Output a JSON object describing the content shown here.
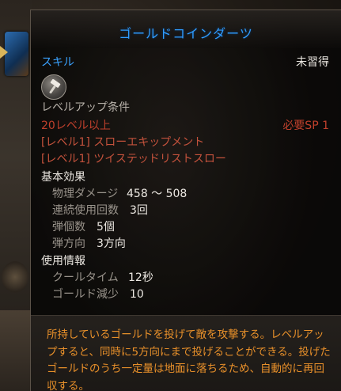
{
  "tooltip": {
    "title": "ゴールドコインダーツ",
    "skill_label": "スキル",
    "learn_status": "未習得",
    "skill_icon": "hammer-icon",
    "req_header": "レベルアップ条件",
    "req_level": "20レベル以上",
    "req_sp": "必要SP 1",
    "prereqs": [
      "[レベル1] スローエキップメント",
      "[レベル1] ツイステッドリストスロー"
    ],
    "basic_header": "基本効果",
    "stats": [
      {
        "label": "物理ダメージ",
        "value": "458 ～ 508"
      },
      {
        "label": "連続使用回数",
        "value": "3回"
      },
      {
        "label": "弾個数",
        "value": "5個"
      },
      {
        "label": "弾方向",
        "value": "3方向"
      }
    ],
    "usage_header": "使用情報",
    "usage": [
      {
        "label": "クールタイム",
        "value": "12秒"
      },
      {
        "label": "ゴールド減少",
        "value": "10"
      }
    ],
    "description": "所持しているゴールドを投げて敵を攻撃する。レベルアップすると、同時に5方向にまで投げることができる。投げたゴールドのうち一定量は地面に落ちるため、自動的に再回収する。"
  },
  "colors": {
    "title": "#2f9cff",
    "requirement_red": "#c0402c",
    "description_orange": "#e8902a"
  }
}
